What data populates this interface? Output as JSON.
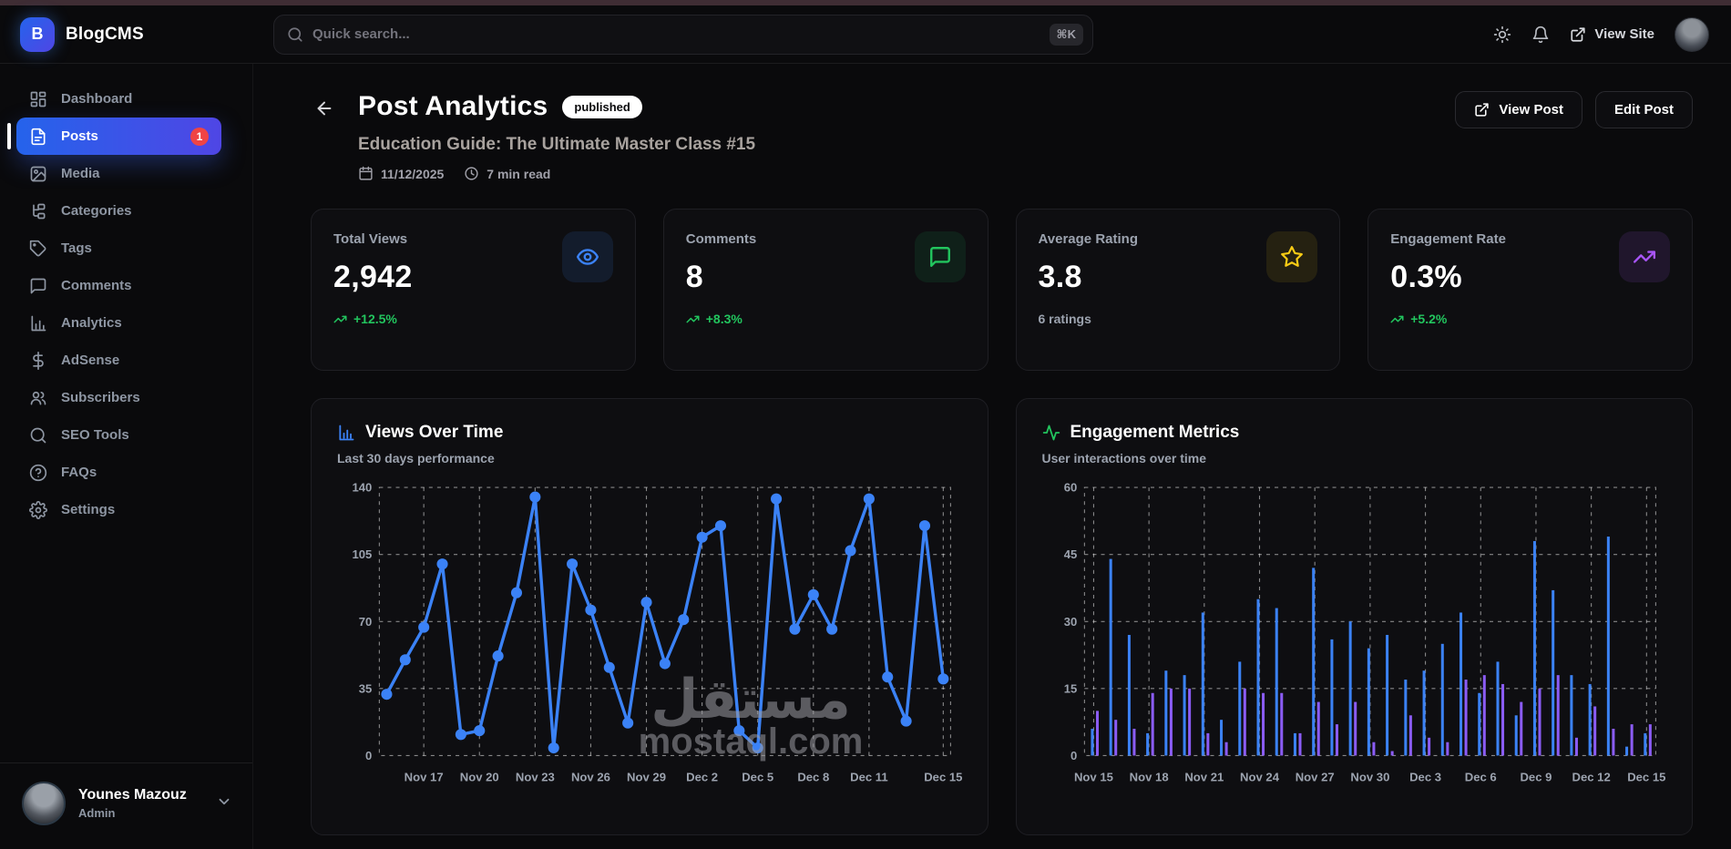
{
  "topbar": {
    "brand_initial": "B",
    "brand_name": "BlogCMS",
    "search": {
      "placeholder": "Quick search...",
      "shortcut": "⌘K"
    },
    "view_site_label": "View Site"
  },
  "sidebar": {
    "items": [
      {
        "label": "Dashboard"
      },
      {
        "label": "Posts",
        "badge": "1"
      },
      {
        "label": "Media"
      },
      {
        "label": "Categories"
      },
      {
        "label": "Tags"
      },
      {
        "label": "Comments"
      },
      {
        "label": "Analytics"
      },
      {
        "label": "AdSense"
      },
      {
        "label": "Subscribers"
      },
      {
        "label": "SEO Tools"
      },
      {
        "label": "FAQs"
      },
      {
        "label": "Settings"
      }
    ],
    "active_item": "Posts",
    "user": {
      "name": "Younes Mazouz",
      "role": "Admin"
    }
  },
  "header": {
    "title": "Post Analytics",
    "status_badge": "published",
    "post_title": "Education Guide: The Ultimate Master Class #15",
    "date": "11/12/2025",
    "read_time": "7 min read",
    "view_post_label": "View Post",
    "edit_post_label": "Edit Post"
  },
  "stats": [
    {
      "label": "Total Views",
      "value": "2,942",
      "change": "+12.5%",
      "icon": "eye-icon",
      "accent": "#3b82f6"
    },
    {
      "label": "Comments",
      "value": "8",
      "change": "+8.3%",
      "icon": "comment-icon",
      "accent": "#22c55e"
    },
    {
      "label": "Average Rating",
      "value": "3.8",
      "sub": "6 ratings",
      "icon": "star-icon",
      "accent": "#facc15"
    },
    {
      "label": "Engagement Rate",
      "value": "0.3%",
      "change": "+5.2%",
      "icon": "trending-up-icon",
      "accent": "#a855f7"
    }
  ],
  "watermark": {
    "line1": "مستقل",
    "line2": "mostaql.com"
  },
  "chart_data": [
    {
      "type": "line",
      "title": "Views Over Time",
      "subtitle": "Last 30 days performance",
      "line_color": "#3b82f6",
      "ylim": [
        0,
        140
      ],
      "yticks": [
        0,
        35,
        70,
        105,
        140
      ],
      "values": [
        32,
        50,
        67,
        100,
        11,
        13,
        52,
        85,
        135,
        4,
        100,
        76,
        46,
        17,
        80,
        48,
        71,
        114,
        120,
        13,
        4,
        134,
        66,
        84,
        66,
        107,
        134,
        41,
        18,
        120,
        40
      ],
      "tick_indices": [
        2,
        5,
        8,
        11,
        14,
        17,
        20,
        23,
        26,
        30
      ],
      "tick_labels": [
        "Nov 17",
        "Nov 20",
        "Nov 23",
        "Nov 26",
        "Nov 29",
        "Dec 2",
        "Dec 5",
        "Dec 8",
        "Dec 11",
        "Dec 15"
      ],
      "grid": "dashed",
      "legend": "none"
    },
    {
      "type": "bar",
      "title": "Engagement Metrics",
      "subtitle": "User interactions over time",
      "ylim": [
        0,
        60
      ],
      "yticks": [
        0,
        15,
        30,
        45,
        60
      ],
      "series": [
        {
          "name": "blue",
          "color": "#3b82f6",
          "values": [
            6,
            44,
            27,
            5,
            19,
            18,
            32,
            8,
            21,
            35,
            33,
            5,
            42,
            26,
            30,
            24,
            27,
            17,
            19,
            25,
            32,
            14,
            21,
            9,
            48,
            37,
            18,
            16,
            49,
            2,
            5
          ]
        },
        {
          "name": "purple",
          "color": "#8b5cf6",
          "values": [
            10,
            8,
            6,
            14,
            15,
            15,
            5,
            3,
            15,
            14,
            14,
            5,
            12,
            7,
            12,
            3,
            1,
            9,
            4,
            3,
            17,
            18,
            16,
            12,
            15,
            18,
            4,
            11,
            6,
            7,
            7
          ]
        }
      ],
      "tick_indices": [
        0,
        3,
        6,
        9,
        12,
        15,
        18,
        21,
        24,
        27,
        30
      ],
      "tick_labels": [
        "Nov 15",
        "Nov 18",
        "Nov 21",
        "Nov 24",
        "Nov 27",
        "Nov 30",
        "Dec 3",
        "Dec 6",
        "Dec 9",
        "Dec 12",
        "Dec 15"
      ],
      "grid": "dashed",
      "legend": "none"
    }
  ]
}
